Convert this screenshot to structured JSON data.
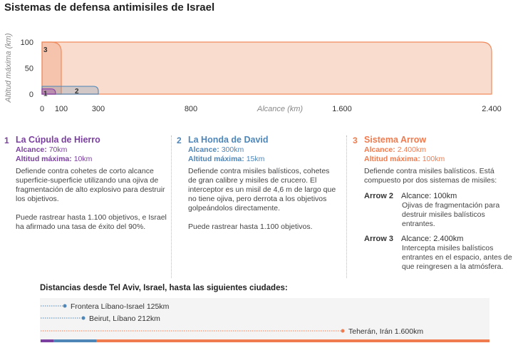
{
  "title": "Sistemas de defensa antimisiles de Israel",
  "chart_data": {
    "type": "area",
    "title": "Sistemas de defensa antimisiles de Israel",
    "xlabel": "Alcance (km)",
    "ylabel": "Altitud máxima (km)",
    "x_ticks": [
      0,
      100,
      300,
      800,
      1600,
      2400
    ],
    "x_tick_labels": [
      "0",
      "100",
      "300",
      "800",
      "1.600",
      "2.400"
    ],
    "y_ticks": [
      0,
      50,
      100
    ],
    "y_tick_labels": [
      "0",
      "50",
      "100"
    ],
    "xlim": [
      0,
      2400
    ],
    "ylim": [
      0,
      100
    ],
    "zones": [
      {
        "label": "1",
        "range_km": 70,
        "altitude_km": 10,
        "color": "#8e44ad"
      },
      {
        "label": "2",
        "range_km": 300,
        "altitude_km": 15,
        "color": "#5b8db8"
      },
      {
        "label": "3",
        "range_km": 100,
        "altitude_km": 100,
        "color": "#f08a5d"
      },
      {
        "label": "",
        "range_km": 2400,
        "altitude_km": 100,
        "color": "#f08a5d"
      }
    ]
  },
  "systems": [
    {
      "number": "1",
      "name": "La Cúpula de Hierro",
      "color": "#7b3fa0",
      "range_label": "Alcance:",
      "range_value": "70km",
      "altitude_label": "Altitud máxima:",
      "altitude_value": "10km",
      "desc1": "Defiende contra cohetes de corto alcance superficie-superficie utilizando una ojiva de fragmentación de alto explosivo para destruir los objetivos.",
      "desc2": "Puede rastrear hasta 1.100 objetivos, e Israel ha afirmado una tasa de éxito del 90%."
    },
    {
      "number": "2",
      "name": "La Honda de David",
      "color": "#4f86b8",
      "range_label": "Alcance:",
      "range_value": "300km",
      "altitude_label": "Altitud máxima:",
      "altitude_value": "15km",
      "desc1": "Defiende contra misiles balísticos, cohetes de gran calibre y misiles de crucero. El interceptor es un misil de 4,6 m de largo que no tiene ojiva, pero derrota a los objetivos golpeándolos directamente.",
      "desc2": "Puede rastrear hasta 1.100 objetivos."
    },
    {
      "number": "3",
      "name": "Sistema Arrow",
      "color": "#ef7b4f",
      "range_label": "Alcance:",
      "range_value": "2.400km",
      "altitude_label": "Altitud máxima:",
      "altitude_value": "100km",
      "desc1": "Defiende contra misiles balísticos. Está compuesto por dos sistemas de misiles:",
      "arrow2_label": "Arrow 2",
      "arrow2_range": "Alcance: 100km",
      "arrow2_desc": "Ojivas de fragmentación para destruir misiles balísticos entrantes.",
      "arrow3_label": "Arrow 3",
      "arrow3_range": "Alcance: 2.400km",
      "arrow3_desc": "Intercepta misiles balísticos entrantes en el espacio, antes de que reingresen a la atmósfera."
    }
  ],
  "distances": {
    "title": "Distancias desde Tel Aviv, Israel, hasta las siguientes ciudades:",
    "cities": [
      {
        "name": "Frontera Líbano-Israel",
        "km": 125,
        "km_label": "125km",
        "color": "#4f86b8"
      },
      {
        "name": "Beirut, Líbano",
        "km": 212,
        "km_label": "212km",
        "color": "#4f86b8"
      },
      {
        "name": "Teherán, Irán",
        "km": 1600,
        "km_label": "1.600km",
        "color": "#ef7b4f"
      }
    ],
    "bar_segments": [
      {
        "from_km": 0,
        "to_km": 70,
        "color": "#7b3fa0"
      },
      {
        "from_km": 70,
        "to_km": 300,
        "color": "#4f86b8"
      },
      {
        "from_km": 300,
        "to_km": 2400,
        "color": "#ef7b4f"
      }
    ]
  }
}
